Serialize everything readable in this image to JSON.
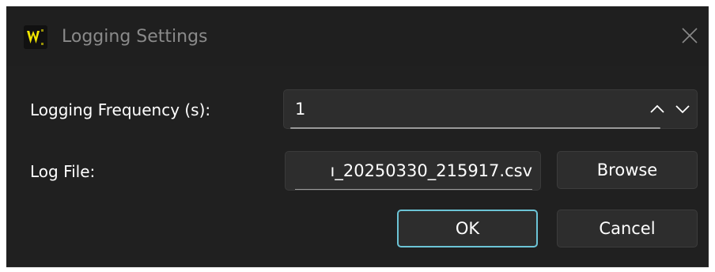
{
  "window": {
    "title": "Logging Settings",
    "app_icon": "w-logo-icon",
    "close_icon": "close-icon"
  },
  "form": {
    "frequency_label": "Logging Frequency (s):",
    "frequency_value": "1",
    "log_file_label": "Log File:",
    "log_file_value": "ı_20250330_215917.csv"
  },
  "buttons": {
    "browse": "Browse",
    "ok": "OK",
    "cancel": "Cancel"
  },
  "colors": {
    "background": "#202020",
    "field_background": "#2d2d2d",
    "ok_focus_border": "#6cc4d6",
    "logo_yellow": "#f2e600"
  }
}
